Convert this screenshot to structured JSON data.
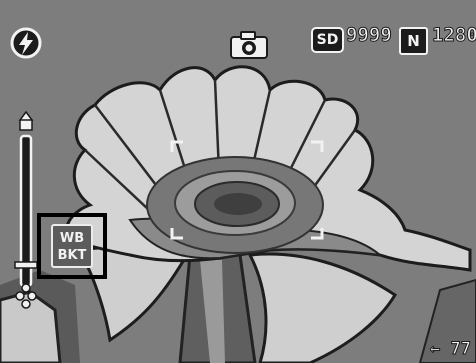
{
  "display": {
    "background": "#7d7d7d",
    "osd_color": "#f2f2f2",
    "outline_color": "#1b1b1b"
  },
  "status_bar": {
    "flash_icon": "flash-auto-icon",
    "mode_icon": "camera-icon",
    "card_label": "SD",
    "shots_remaining": "9999",
    "quality_label": "N",
    "image_size": "1280"
  },
  "left_panel": {
    "zoom_icon": "zoom-bar-icon",
    "wb_bracket_line1": "WB",
    "wb_bracket_line2": "BKT"
  },
  "bottom_right": {
    "indicator_text": "← 77"
  },
  "focus_frame": {
    "color": "#f2f2f2"
  }
}
